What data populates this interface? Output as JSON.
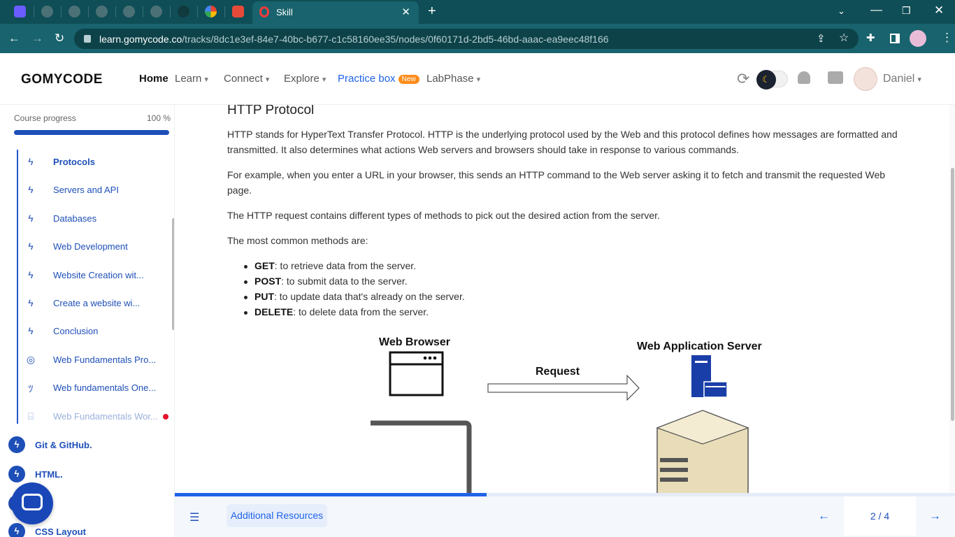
{
  "browser": {
    "active_tab_title": "Skill",
    "url_host": "learn.gomycode.co",
    "url_path": "/tracks/8dc1e3ef-84e7-40bc-b677-c1c58160ee35/nodes/0f60171d-2bd5-46bd-aaac-ea9eec48f166",
    "theme_color": "#0f4e56"
  },
  "header": {
    "logo": "GOMYCODE",
    "nav": {
      "home": "Home",
      "learn": "Learn",
      "connect": "Connect",
      "explore": "Explore",
      "practice_box": "Practice box",
      "practice_badge": "New",
      "labphase": "LabPhase"
    },
    "user_name": "Daniel"
  },
  "sidebar": {
    "progress_label": "Course progress",
    "progress_value": "100 %",
    "progress_fraction": 1.0,
    "items": [
      {
        "label": "Protocols",
        "icon": "bolt-icon"
      },
      {
        "label": "Servers and API",
        "icon": "bolt-icon"
      },
      {
        "label": "Databases",
        "icon": "bolt-icon"
      },
      {
        "label": "Web Development",
        "icon": "bolt-icon"
      },
      {
        "label": "Website Creation wit...",
        "icon": "bolt-icon"
      },
      {
        "label": "Create a website wi...",
        "icon": "bolt-icon"
      },
      {
        "label": "Conclusion",
        "icon": "bolt-icon"
      },
      {
        "label": "Web Fundamentals Pro...",
        "icon": "target-icon"
      },
      {
        "label": "Web fundamentals One...",
        "icon": "people-icon"
      },
      {
        "label": "Web Fundamentals Wor...",
        "icon": "workshop-icon"
      }
    ],
    "modules": [
      {
        "label": "Git & GitHub."
      },
      {
        "label": "HTML."
      },
      {
        "label": "."
      },
      {
        "label": "CSS Layout"
      }
    ]
  },
  "content": {
    "title": "HTTP Protocol",
    "p1": "HTTP stands for HyperText Transfer Protocol. HTTP is the underlying protocol used by the Web and this protocol defines how messages are formatted and transmitted. It also determines what actions Web servers and browsers should take in response to various commands.",
    "p2": "For example, when you enter a URL in your browser, this sends an HTTP command to the Web server asking it to fetch and transmit the requested Web page.",
    "p3": "The HTTP request contains different types of methods to pick out the desired action from the server.",
    "p4": "The most common methods are:",
    "methods": [
      {
        "name": "GET",
        "desc": ": to retrieve data from the server."
      },
      {
        "name": "POST",
        "desc": ": to submit data to the server."
      },
      {
        "name": "PUT",
        "desc": ": to update data that's already on the server."
      },
      {
        "name": "DELETE",
        "desc": ": to delete data from the server."
      }
    ],
    "diagram": {
      "left_label": "Web Browser",
      "right_label": "Web Application Server",
      "arrow_label": "Request"
    }
  },
  "footer": {
    "resources_label": "Additional Resources",
    "page_indicator": "2 / 4",
    "lesson_progress_fraction": 0.4
  }
}
